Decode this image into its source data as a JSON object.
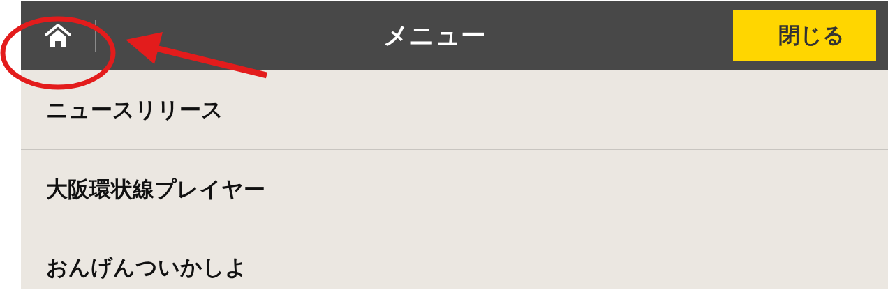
{
  "header": {
    "title": "メニュー",
    "close_button": "閉じる"
  },
  "menu_items": [
    {
      "label": "ニュースリリース"
    },
    {
      "label": "大阪環状線プレイヤー"
    },
    {
      "label": "おんげんついかしよ"
    }
  ],
  "home_highlight": {
    "circled": true,
    "arrow": true
  }
}
